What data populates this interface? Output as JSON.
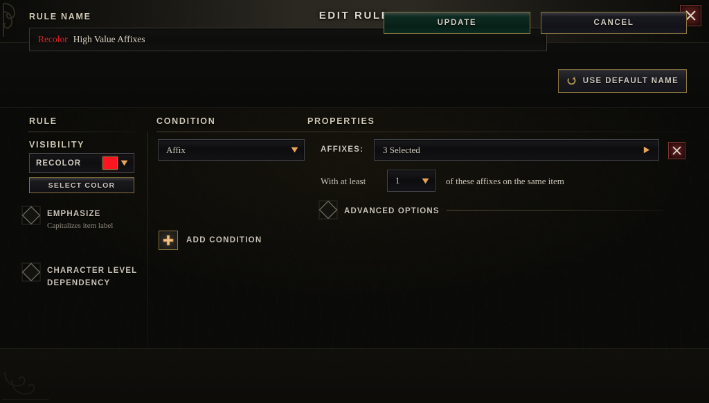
{
  "window": {
    "title": "EDIT RULE",
    "close_icon": "close-x-icon"
  },
  "rule_name": {
    "label": "RULE NAME",
    "value_prefix": "Recolor",
    "value": "High Value Affixes",
    "placeholder": "Rule name",
    "prefix_color": "#d8242a",
    "default_button": {
      "label": "USE DEFAULT NAME",
      "icon": "refresh-circular-arrow-icon"
    }
  },
  "columns": {
    "rule": "RULE",
    "condition": "CONDITION",
    "properties": "PROPERTIES"
  },
  "sidebar": {
    "visibility_label": "VISIBILITY",
    "visibility_value": "RECOLOR",
    "visibility_caret": "chevron-down-icon",
    "swatch_color": "#ff1520",
    "select_color_label": "SELECT COLOR",
    "toggles": [
      {
        "title": "EMPHASIZE",
        "subtitle": "Capitalizes item label",
        "checked": false
      },
      {
        "title": "CHARACTER LEVEL DEPENDENCY",
        "title_line1": "CHARACTER LEVEL",
        "title_line2": "DEPENDENCY",
        "checked": false
      }
    ]
  },
  "condition": {
    "select_value": "Affix",
    "select_caret": "chevron-down-icon",
    "add_condition_label": "ADD CONDITION",
    "add_condition_icon": "plus-icon"
  },
  "properties": {
    "affixes_label": "AFFIXES:",
    "affixes_value": "3 Selected",
    "affixes_caret": "chevron-right-icon",
    "affixes_delete_icon": "close-x-icon",
    "at_least_prefix": "With at least",
    "at_least_count": "1",
    "at_least_caret": "chevron-down-icon",
    "at_least_suffix": "of these affixes on the same item",
    "advanced_options_label": "ADVANCED OPTIONS",
    "advanced_options_checked": false
  },
  "footer": {
    "update_label": "UPDATE",
    "cancel_label": "CANCEL"
  },
  "colors": {
    "accent_gold": "#8a7540",
    "text_primary": "#cfc8b4",
    "recolor_red": "#d8242a",
    "update_green": "#0d2b22",
    "danger_red": "#5a1c1b"
  }
}
